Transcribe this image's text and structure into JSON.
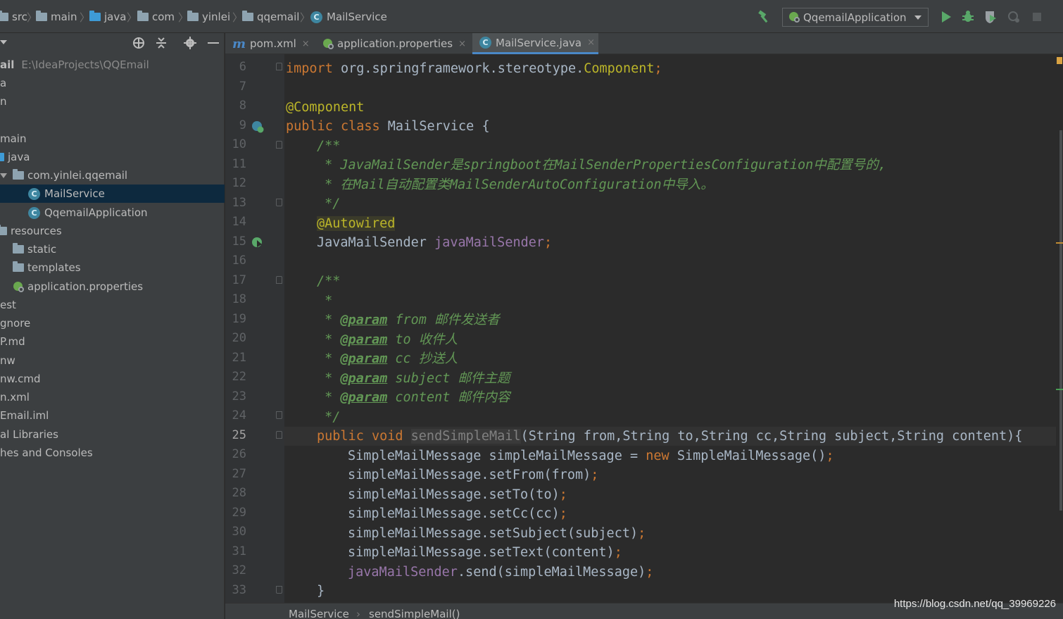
{
  "breadcrumb": {
    "items": [
      "src",
      "main",
      "java",
      "com",
      "yinlei",
      "qqemail",
      "MailService"
    ]
  },
  "toolbar": {
    "run_config": "QqemailApplication"
  },
  "project": {
    "rows": [
      {
        "label": "ail",
        "path": "E:\\IdeaProjects\\QQEmail"
      },
      {
        "label": "a"
      },
      {
        "label": "n"
      },
      {
        "label": ""
      },
      {
        "label": "main"
      },
      {
        "label": "java"
      },
      {
        "label": "com.yinlei.qqemail"
      },
      {
        "label": "MailService"
      },
      {
        "label": "QqemailApplication"
      },
      {
        "label": "resources"
      },
      {
        "label": "static"
      },
      {
        "label": "templates"
      },
      {
        "label": "application.properties"
      },
      {
        "label": "est"
      },
      {
        "label": "gnore"
      },
      {
        "label": "P.md"
      },
      {
        "label": "nw"
      },
      {
        "label": "nw.cmd"
      },
      {
        "label": "n.xml"
      },
      {
        "label": "Email.iml"
      },
      {
        "label": "al Libraries"
      },
      {
        "label": "hes and Consoles"
      }
    ]
  },
  "tabs": [
    {
      "label": "pom.xml",
      "close": "×",
      "icon": "maven-icon"
    },
    {
      "label": "application.properties",
      "close": "×",
      "icon": "spring-icon"
    },
    {
      "label": "MailService.java",
      "close": "×",
      "icon": "class-icon",
      "active": true
    }
  ],
  "editor": {
    "line_numbers": [
      "6",
      "7",
      "8",
      "9",
      "10",
      "11",
      "12",
      "13",
      "14",
      "15",
      "16",
      "17",
      "18",
      "19",
      "20",
      "21",
      "22",
      "23",
      "24",
      "25",
      "26",
      "27",
      "28",
      "29",
      "30",
      "31",
      "32",
      "33"
    ],
    "current_line": "25",
    "code": {
      "l6_kw": "import ",
      "l6_pkg": "org.springframework.stereotype.",
      "l6_cls": "Component",
      "l6_semi": ";",
      "l8": "@Component",
      "l9_kw": "public class ",
      "l9_name": "MailService {",
      "l10": "/**",
      "l11": " * JavaMailSender是springboot在MailSenderPropertiesConfiguration中配置号的,",
      "l12": " * 在Mail自动配置类MailSenderAutoConfiguration中导入。",
      "l13": " */",
      "l14": "@Autowired",
      "l15_type": "JavaMailSender ",
      "l15_field": "javaMailSender",
      "l15_semi": ";",
      "l17": "/**",
      "l18": " *",
      "l19_tag": "@param",
      "l19_rest": " from 邮件发送者",
      "l20_tag": "@param",
      "l20_rest": " to 收件人",
      "l21_tag": "@param",
      "l21_rest": " cc 抄送人",
      "l22_tag": "@param",
      "l22_rest": " subject 邮件主题",
      "l23_tag": "@param",
      "l23_rest": " content 邮件内容",
      "l24": " */",
      "l25_kw": "public void ",
      "l25_name": "sendSimpleMail",
      "l25_sig": "(String from,String to,String cc,String subject,String content){",
      "l26_a": "SimpleMailMessage simpleMailMessage = ",
      "l26_kw": "new ",
      "l26_b": "SimpleMailMessage()",
      "l27": "simpleMailMessage.setFrom(from)",
      "l28": "simpleMailMessage.setTo(to)",
      "l29": "simpleMailMessage.setCc(cc)",
      "l30": "simpleMailMessage.setSubject(subject)",
      "l31": "simpleMailMessage.setText(content)",
      "l32_field": "javaMailSender",
      "l32_rest": ".send(simpleMailMessage)",
      "semi": ";",
      "l33": "}"
    }
  },
  "status": {
    "crumb1": "MailService",
    "sep": "›",
    "crumb2": "sendSimpleMail()"
  },
  "watermark": "https://blog.csdn.net/qq_39969226",
  "colors": {
    "keyword": "#cc7832",
    "annotation": "#bbb529",
    "doc": "#629755",
    "field": "#9876aa",
    "text": "#a9b7c6"
  }
}
